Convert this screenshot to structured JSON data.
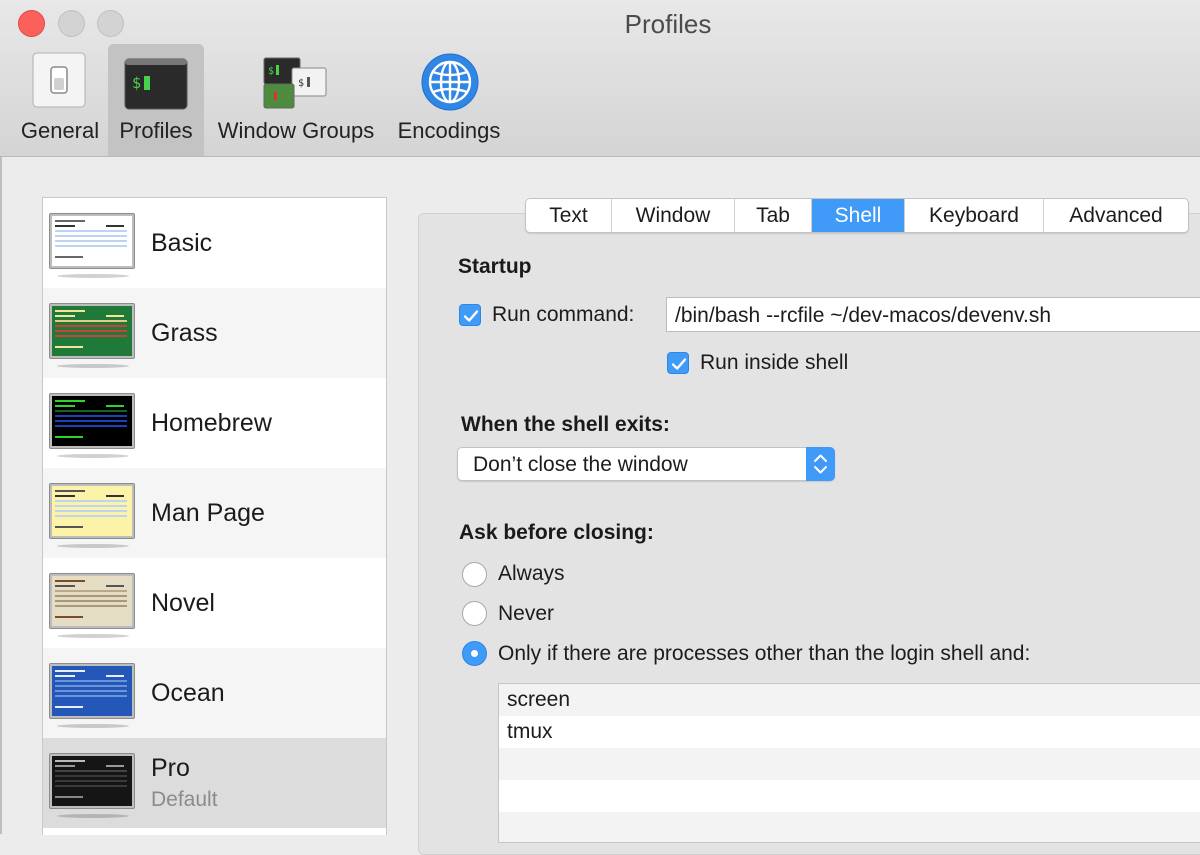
{
  "window": {
    "title": "Profiles"
  },
  "toolbar": {
    "items": [
      {
        "label": "General",
        "icon": "switch-icon"
      },
      {
        "label": "Profiles",
        "icon": "terminal-icon",
        "selected": true
      },
      {
        "label": "Window Groups",
        "icon": "window-groups-icon"
      },
      {
        "label": "Encodings",
        "icon": "globe-icon"
      }
    ]
  },
  "profiles": [
    {
      "name": "Basic",
      "theme": "basic"
    },
    {
      "name": "Grass",
      "theme": "grass"
    },
    {
      "name": "Homebrew",
      "theme": "homebrew"
    },
    {
      "name": "Man Page",
      "theme": "manpage"
    },
    {
      "name": "Novel",
      "theme": "novel"
    },
    {
      "name": "Ocean",
      "theme": "ocean"
    },
    {
      "name": "Pro",
      "subtitle": "Default",
      "theme": "pro",
      "selected": true
    }
  ],
  "tabs": [
    {
      "label": "Text"
    },
    {
      "label": "Window"
    },
    {
      "label": "Tab"
    },
    {
      "label": "Shell",
      "active": true
    },
    {
      "label": "Keyboard"
    },
    {
      "label": "Advanced"
    }
  ],
  "startup": {
    "heading": "Startup",
    "run_command_label": "Run command:",
    "run_command_checked": true,
    "command_value": "/bin/bash --rcfile ~/dev-macos/devenv.sh",
    "run_inside_shell_label": "Run inside shell",
    "run_inside_shell_checked": true
  },
  "shell_exit": {
    "heading": "When the shell exits:",
    "selected_option": "Don’t close the window"
  },
  "ask_closing": {
    "heading": "Ask before closing:",
    "options": [
      {
        "label": "Always",
        "selected": false
      },
      {
        "label": "Never",
        "selected": false
      },
      {
        "label": "Only if there are processes other than the login shell and:",
        "selected": true
      }
    ],
    "processes": [
      "screen",
      "tmux"
    ]
  },
  "colors": {
    "accent": "#3f9af8"
  }
}
